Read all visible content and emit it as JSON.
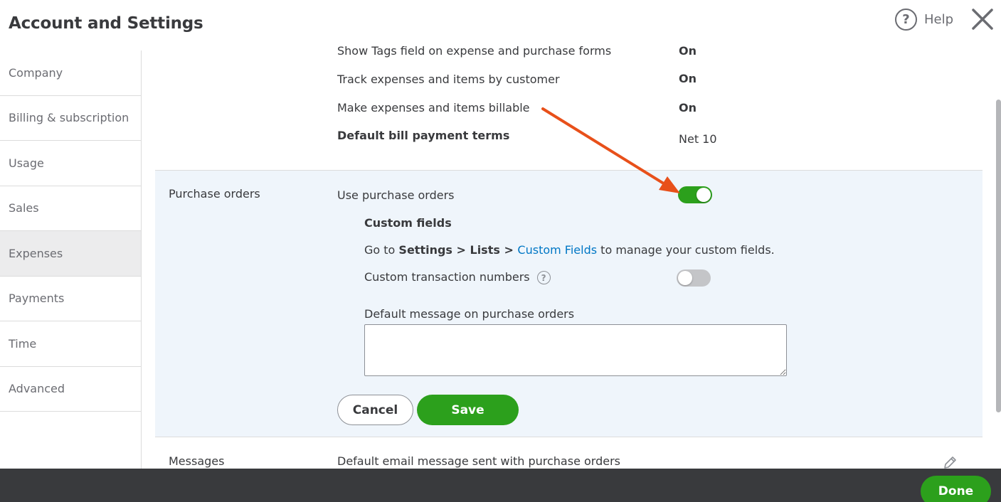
{
  "header": {
    "title": "Account and Settings",
    "help_label": "Help",
    "help_glyph": "?"
  },
  "sidebar": {
    "items": [
      {
        "label": "Company"
      },
      {
        "label": "Billing & subscription"
      },
      {
        "label": "Usage"
      },
      {
        "label": "Sales"
      },
      {
        "label": "Expenses",
        "active": true
      },
      {
        "label": "Payments"
      },
      {
        "label": "Time"
      },
      {
        "label": "Advanced"
      }
    ]
  },
  "bills": {
    "show_tags_label": "Show Tags field on expense and purchase forms",
    "show_tags_value": "On",
    "track_label": "Track expenses and items by customer",
    "track_value": "On",
    "billable_label": "Make expenses and items billable",
    "billable_value": "On",
    "terms_label": "Default bill payment terms",
    "terms_value": "Net 10"
  },
  "purchase_orders": {
    "section_label": "Purchase orders",
    "use_po_label": "Use purchase orders",
    "use_po_enabled": true,
    "custom_fields_title": "Custom fields",
    "custom_fields_prefix": "Go to ",
    "custom_fields_path": "Settings > Lists > ",
    "custom_fields_link": "Custom Fields",
    "custom_fields_suffix": " to manage your custom fields.",
    "custom_txn_label": "Custom transaction numbers",
    "custom_txn_enabled": false,
    "info_glyph": "?",
    "default_message_label": "Default message on purchase orders",
    "default_message_value": "",
    "cancel_label": "Cancel",
    "save_label": "Save"
  },
  "messages": {
    "section_label": "Messages",
    "email_label": "Default email message sent with purchase orders"
  },
  "footer": {
    "done_label": "Done"
  },
  "colors": {
    "accent_green": "#2ca01c",
    "link_blue": "#0077c5",
    "annotation_arrow": "#e8501a",
    "section_highlight": "#eff5fb",
    "footer_bg": "#393a3d"
  }
}
